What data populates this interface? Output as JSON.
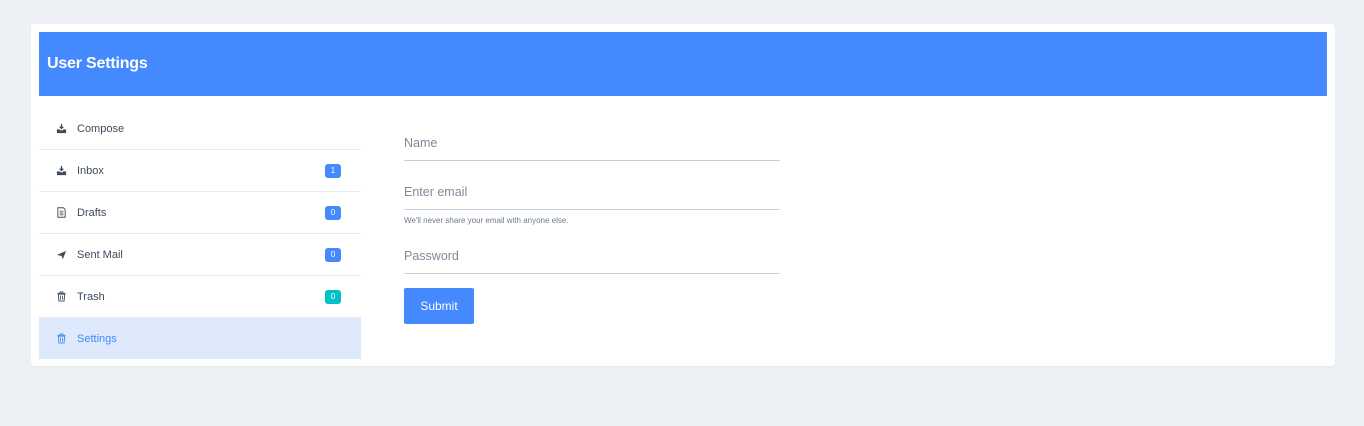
{
  "header": {
    "title": "User Settings"
  },
  "colors": {
    "accent": "#4489fd",
    "cyan_badge": "#01c0c8",
    "active_bg": "#dfe9fc"
  },
  "sidebar": {
    "items": [
      {
        "label": "Compose",
        "icon": "inbox-download-icon",
        "badge": null
      },
      {
        "label": "Inbox",
        "icon": "inbox-download-icon",
        "badge": "1"
      },
      {
        "label": "Drafts",
        "icon": "document-icon",
        "badge": "0"
      },
      {
        "label": "Sent Mail",
        "icon": "paper-plane-icon",
        "badge": "0"
      },
      {
        "label": "Trash",
        "icon": "trash-icon",
        "badge": "0"
      },
      {
        "label": "Settings",
        "icon": "trash-icon",
        "badge": null,
        "active": true
      }
    ]
  },
  "form": {
    "name_placeholder": "Name",
    "email_placeholder": "Enter email",
    "email_help": "We'll never share your email with anyone else.",
    "password_placeholder": "Password",
    "submit_label": "Submit"
  }
}
